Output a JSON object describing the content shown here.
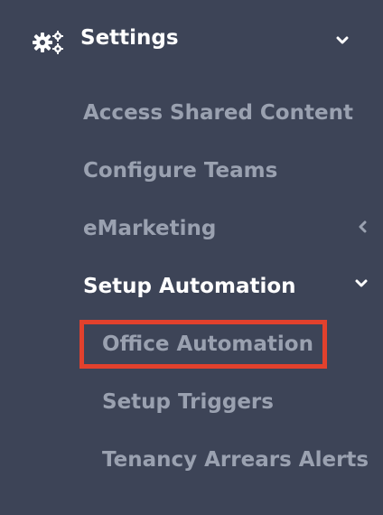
{
  "sidebar": {
    "header": {
      "label": "Settings",
      "icon": "gears-icon",
      "expanded": true
    },
    "items": [
      {
        "label": "Access Shared Content"
      },
      {
        "label": "Configure Teams"
      },
      {
        "label": "eMarketing",
        "has_children": true,
        "expanded": false
      },
      {
        "label": "Setup Automation",
        "has_children": true,
        "expanded": true,
        "active": true
      }
    ],
    "sub_items": [
      {
        "label": "Office Automation",
        "highlighted": true
      },
      {
        "label": "Setup Triggers"
      },
      {
        "label": "Tenancy Arrears Alerts"
      }
    ]
  },
  "colors": {
    "background": "#3d4457",
    "text_muted": "#9aa1b0",
    "text_active": "#ffffff",
    "highlight": "#e2412d"
  }
}
